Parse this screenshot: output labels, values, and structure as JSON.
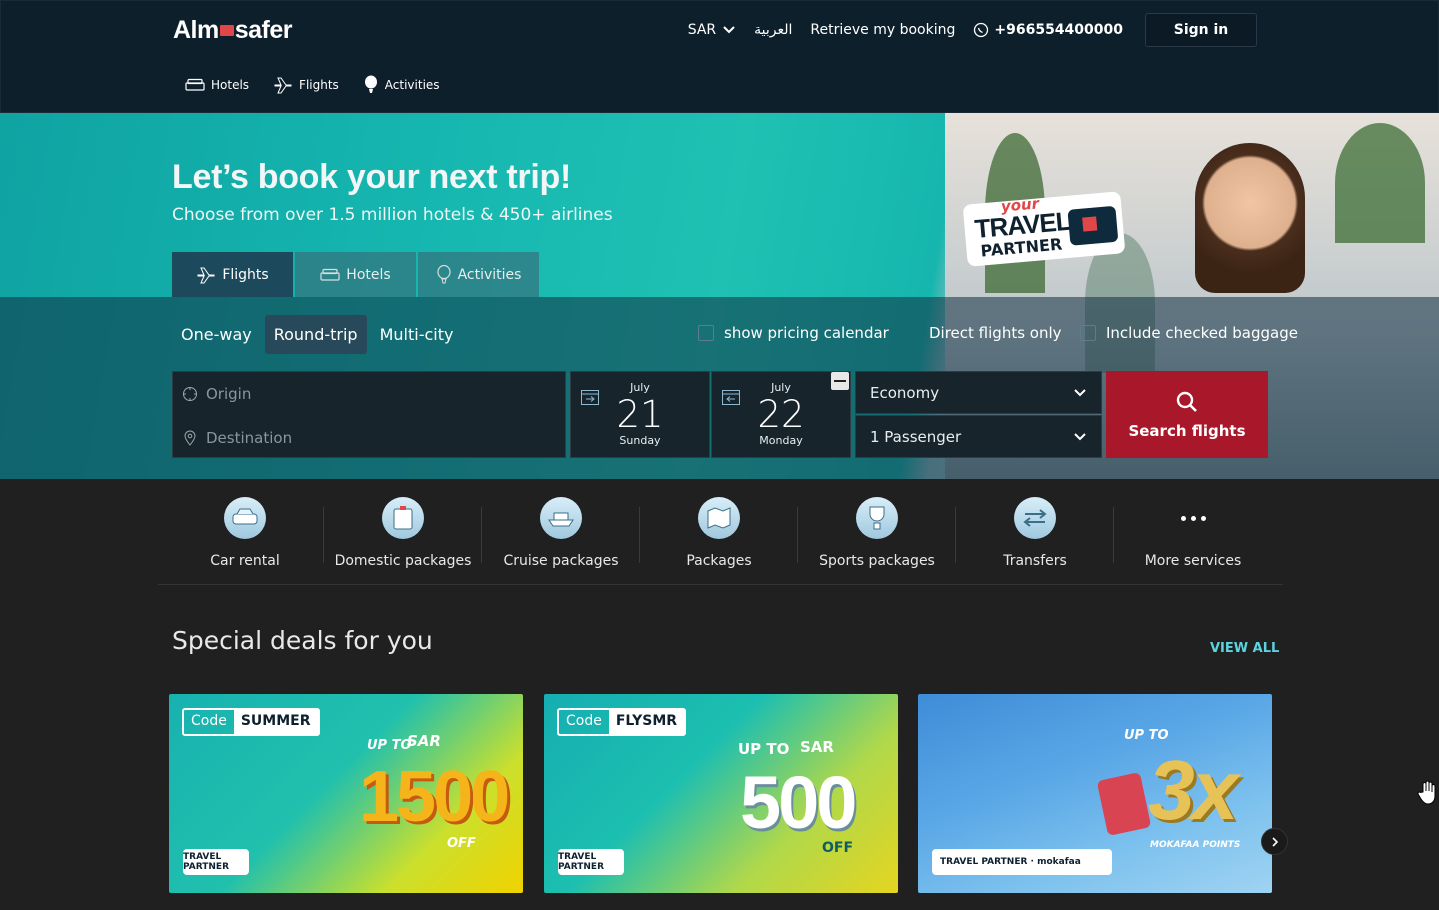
{
  "header": {
    "logo_text_a": "Alm",
    "logo_text_b": "safer",
    "currency": "SAR",
    "language": "العربية",
    "retrieve_booking": "Retrieve my booking",
    "phone": "+966554400000",
    "sign_in": "Sign in"
  },
  "subnav": [
    {
      "label": "Hotels",
      "icon": "bed-icon"
    },
    {
      "label": "Flights",
      "icon": "plane-icon"
    },
    {
      "label": "Activities",
      "icon": "balloon-icon"
    }
  ],
  "hero": {
    "title": "Let’s book your next trip!",
    "subtitle": "Choose from over 1.5 million hotels & 450+ airlines",
    "badge_your": "your",
    "badge_travel": "TRAVEL",
    "badge_partner": "PARTNER",
    "tabs": [
      {
        "label": "Flights",
        "icon": "plane-icon",
        "active": true
      },
      {
        "label": "Hotels",
        "icon": "bed-icon",
        "active": false
      },
      {
        "label": "Activities",
        "icon": "balloon-icon",
        "active": false
      }
    ]
  },
  "search": {
    "trip_types": [
      "One-way",
      "Round-trip",
      "Multi-city"
    ],
    "selected_trip": "Round-trip",
    "show_pricing_calendar": "show pricing calendar",
    "direct_flights": "Direct flights only",
    "checked_baggage": "Include checked baggage",
    "origin_placeholder": "Origin",
    "destination_placeholder": "Destination",
    "depart": {
      "month": "July",
      "day": "21",
      "weekday": "Sunday"
    },
    "return": {
      "month": "July",
      "day": "22",
      "weekday": "Monday"
    },
    "cabin": "Economy",
    "passengers": "1 Passenger",
    "button": "Search flights"
  },
  "services": [
    {
      "label": "Car rental",
      "icon": "car-icon"
    },
    {
      "label": "Domestic packages",
      "icon": "suitcase-icon"
    },
    {
      "label": "Cruise packages",
      "icon": "ship-icon"
    },
    {
      "label": "Packages",
      "icon": "map-icon"
    },
    {
      "label": "Sports packages",
      "icon": "trophy-icon"
    },
    {
      "label": "Transfers",
      "icon": "arrows-icon"
    },
    {
      "label": "More services",
      "icon": "more-icon"
    }
  ],
  "deals": {
    "title": "Special deals for you",
    "view_all": "VIEW ALL",
    "cards": [
      {
        "code_label": "Code",
        "code": "SUMMER",
        "upto": "UP TO",
        "currency": "SAR",
        "amount": "1500",
        "off": "OFF"
      },
      {
        "code_label": "Code",
        "code": "FLYSMR",
        "upto": "UP TO",
        "currency": "SAR",
        "amount": "500",
        "off": "OFF"
      },
      {
        "upto": "UP TO",
        "amount": "3x",
        "note": "MOKAFAA POINTS"
      }
    ]
  }
}
